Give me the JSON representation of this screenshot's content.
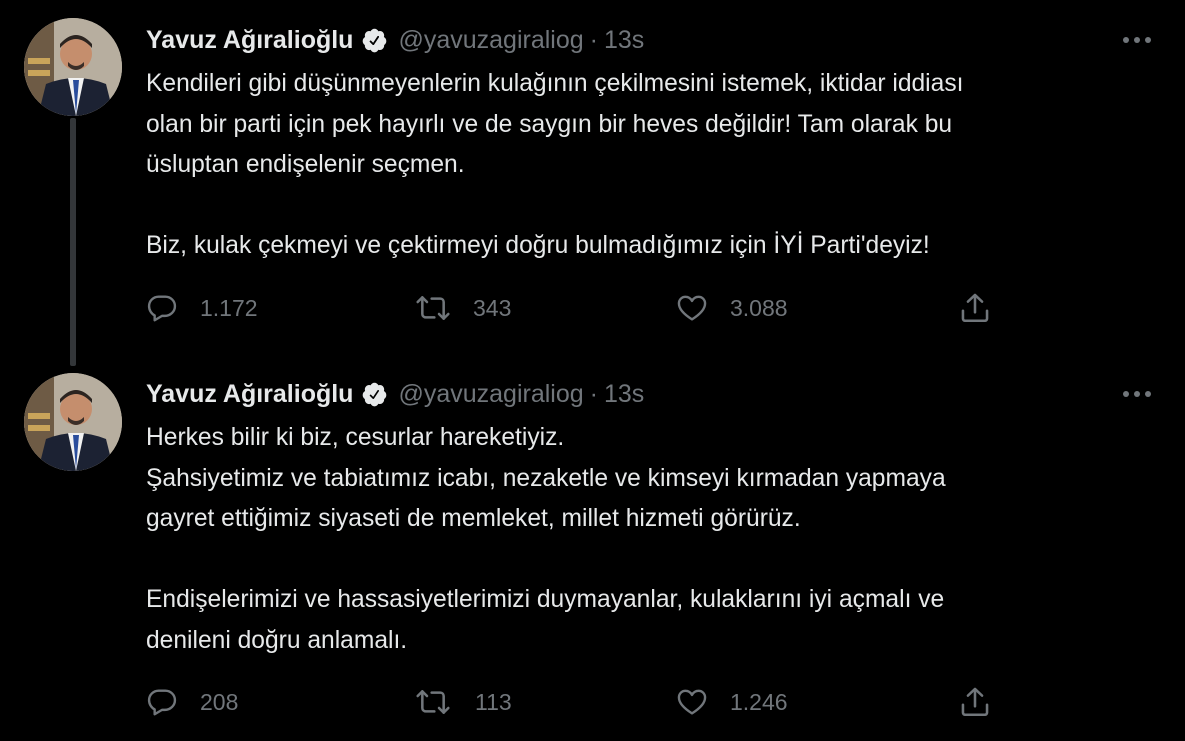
{
  "tweets": [
    {
      "author": {
        "name": "Yavuz Ağıralioğlu",
        "handle": "@yavuzagiraliog",
        "verified": true
      },
      "separator": "·",
      "time": "13s",
      "text_lines": [
        "Kendileri gibi düşünmeyenlerin kulağının çekilmesini istemek, iktidar iddiası",
        "olan bir parti için pek hayırlı ve de saygın bir heves değildir! Tam olarak bu",
        "üsluptan endişelenir seçmen.",
        "",
        "Biz, kulak çekmeyi ve çektirmeyi doğru bulmadığımız için İYİ Parti'deyiz!"
      ],
      "stats": {
        "replies": "1.172",
        "retweets": "343",
        "likes": "3.088"
      }
    },
    {
      "author": {
        "name": "Yavuz Ağıralioğlu",
        "handle": "@yavuzagiraliog",
        "verified": true
      },
      "separator": "·",
      "time": "13s",
      "text_lines": [
        "Herkes bilir ki biz, cesurlar hareketiyiz.",
        "Şahsiyetimiz ve tabiatımız icabı, nezaketle ve kimseyi kırmadan yapmaya",
        "gayret ettiğimiz siyaseti de memleket, millet hizmeti görürüz.",
        "",
        "Endişelerimizi ve hassasiyetlerimizi duymayanlar, kulaklarını iyi açmalı ve",
        "denileni doğru anlamalı."
      ],
      "stats": {
        "replies": "208",
        "retweets": "113",
        "likes": "1.246"
      }
    }
  ],
  "icons": {
    "verified": "verified-badge-icon",
    "more": "more-dots-icon",
    "reply": "reply-icon",
    "retweet": "retweet-icon",
    "like": "heart-icon",
    "share": "share-icon"
  },
  "colors": {
    "background": "#000000",
    "text": "#e7e9ea",
    "secondary": "#71767b",
    "thread_line": "#333639",
    "verified_badge": "#e7e9ea"
  }
}
